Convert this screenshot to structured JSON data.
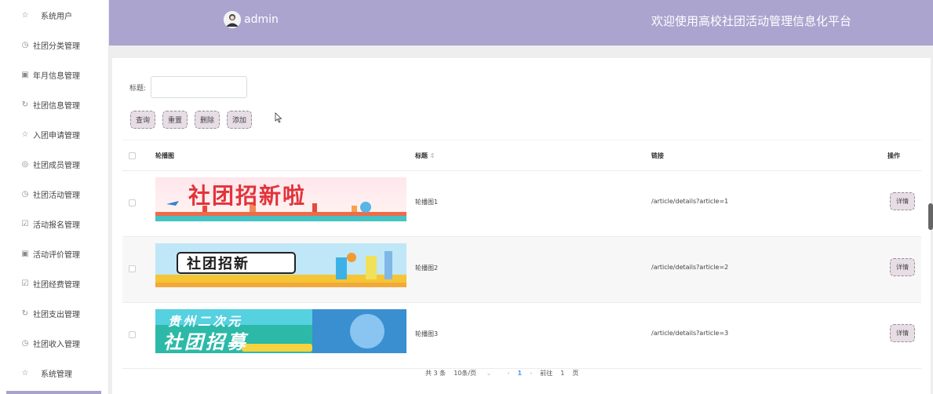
{
  "sidebar": {
    "items": [
      {
        "label": "系统用户",
        "icon": "star-icon",
        "plain": true
      },
      {
        "label": "社团分类管理",
        "icon": "clock-icon"
      },
      {
        "label": "年月信息管理",
        "icon": "calendar-icon"
      },
      {
        "label": "社团信息管理",
        "icon": "refresh-icon"
      },
      {
        "label": "入团申请管理",
        "icon": "star-icon"
      },
      {
        "label": "社团成员管理",
        "icon": "compass-icon"
      },
      {
        "label": "社团活动管理",
        "icon": "clock-icon"
      },
      {
        "label": "活动报名管理",
        "icon": "check-box-icon"
      },
      {
        "label": "活动评价管理",
        "icon": "calendar-icon"
      },
      {
        "label": "社团经费管理",
        "icon": "check-box-icon"
      },
      {
        "label": "社团支出管理",
        "icon": "refresh-icon"
      },
      {
        "label": "社团收入管理",
        "icon": "clock-icon"
      },
      {
        "label": "系统管理",
        "icon": "star-icon",
        "plain": true
      }
    ]
  },
  "header": {
    "username": "admin",
    "title": "欢迎使用高校社团活动管理信息化平台",
    "bg_color": "#aba4cf"
  },
  "search": {
    "label": "标题:",
    "value": ""
  },
  "actions": {
    "query": "查询",
    "reset": "重置",
    "delete": "删除",
    "add": "添加"
  },
  "table": {
    "headers": {
      "image": "轮播图",
      "title": "标题",
      "link": "链接",
      "op": "操作"
    },
    "rows": [
      {
        "banner_text": "社团招新啦",
        "title": "轮播图1",
        "link": "/article/details?article=1",
        "detail": "详情"
      },
      {
        "banner_text": "社团招新",
        "title": "轮播图2",
        "link": "/article/details?article=2",
        "detail": "详情"
      },
      {
        "banner_text": "社团招募",
        "banner_text_top": "贵州二次元",
        "title": "轮播图3",
        "link": "/article/details?article=3",
        "detail": "详情"
      }
    ]
  },
  "pager": {
    "total": "共 3 条",
    "page_size": "10条/页",
    "current": "1",
    "goto_label": "前往",
    "goto_value": "1",
    "page_suffix": "页"
  }
}
